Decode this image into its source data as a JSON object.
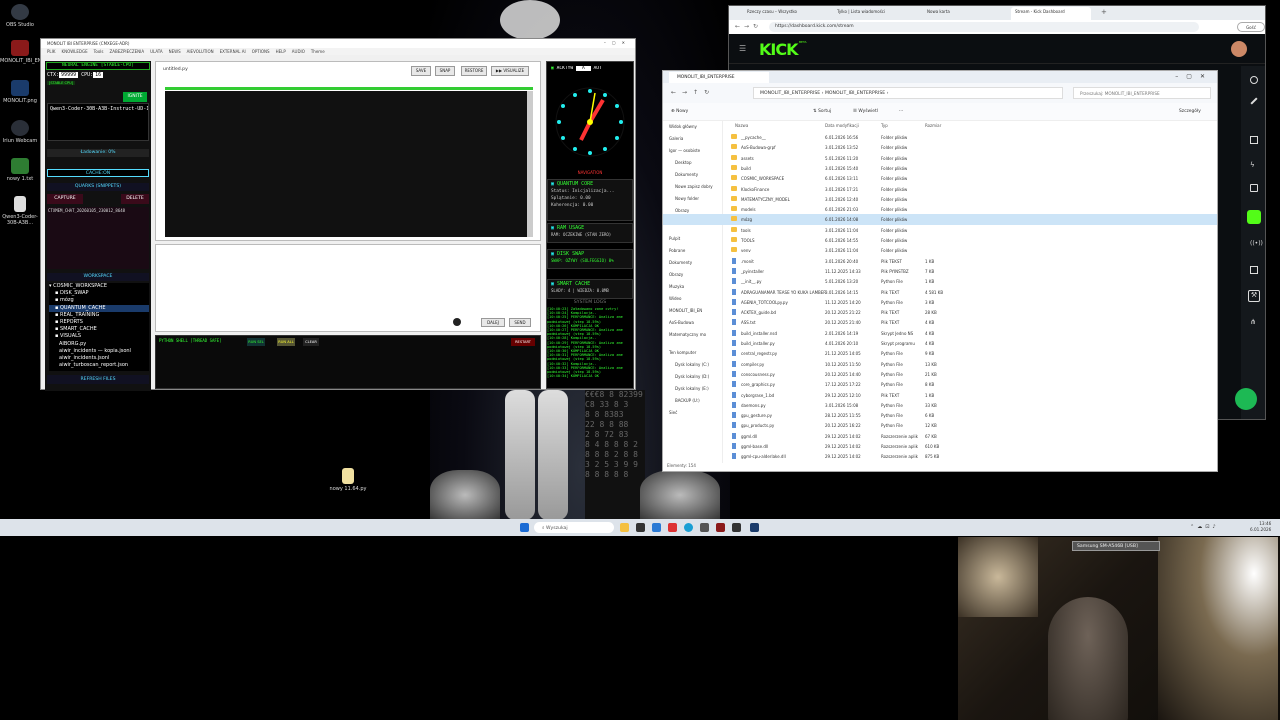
{
  "desktop": {
    "icons": [
      {
        "label": "OBS Studio",
        "color": "#333a44"
      },
      {
        "label": "MONOLIT_IBI_ENTERPRISE",
        "color": "#8b1a1a"
      },
      {
        "label": "MONOLIT.png",
        "color": "#1a3b6b"
      },
      {
        "label": "Iriun Webcam",
        "color": "#2a2f38"
      },
      {
        "label": "nowy 1.txt",
        "color": "#2e7d32"
      },
      {
        "label": "Qwen3-Coder-30B-A3B...",
        "color": "#dddddd"
      }
    ],
    "dropped_file": "nowy 11.64.py"
  },
  "app": {
    "title": "MONOLIT IBI ENTERPRISE (CMXEGE-ADR)",
    "menu": [
      "PLIK",
      "KNOWLEDGE",
      "Tools",
      "ZABEZPIECZENIA",
      "ULATA",
      "NEWS",
      "AIEVOLUTION",
      "EXTERNAL AI",
      "OPTIONS",
      "HELP",
      "AUDIO",
      "Theme"
    ],
    "neural_engine": "NEURAL ENGINE [STABLE-CPU]",
    "ctx_label": "CTX:",
    "ctx_value": "99999",
    "cpu_label": "CPU:",
    "cpu_value": "16",
    "model_status": "[STABLE CPU]",
    "ignite": "IGNITE",
    "model": "Qwen3-Coder-30B-A3B-Instruct-UD-IQ1",
    "loading": "Ładowanie: 0%",
    "cache": "CACHE:ON",
    "quarks": "QUARKS (SNIPPETS)",
    "capture": "CAPTURE",
    "delete": "DELETE",
    "quark_item": "CTXMEM_CHAT_20260105_230012_8648",
    "workspace": "WORKSPACE",
    "tree": [
      "COSMIC_WORKSPACE",
      "DISK_SWAP",
      "mózg",
      "QUANTUM_CACHE",
      "REAL_TRAINING",
      "REPORTS",
      "SMART_CACHE",
      "VISUALS",
      "AIBORG.py",
      "aiwir_incidents — kopia.jsonl",
      "aiwir_incidents.jsonl",
      "aiwir_turboscan_report.json"
    ],
    "refresh": "REFRESH FILES",
    "editor_file": "untitled.py",
    "save": "SAVE",
    "snap": "SNAP",
    "restore": "RESTORE",
    "visualize": "▶▶ VISUALIZE",
    "dalej": "DALEJ",
    "send": "SEND",
    "shell_title": "PYTHON SHELL [THREAD SAFE]",
    "run_sel": "RUN SEL",
    "run_all": "RUN ALL",
    "clear": "CLEAR",
    "restart": "RESTART",
    "actyw": "ACKTYW",
    "actyw_value": "A",
    "aut": "AUT",
    "clock_label": "NAVIGATION",
    "quantum_core": "QUANTUM CORE",
    "qc_status": "Status: Inicjalizacja...",
    "qc_splat": "Splątanie: 0.00",
    "qc_koh": "Koherencja: 0.00",
    "ram": "RAM USAGE",
    "ram_value": "RAM: OCZEKIWE (STAN ZERO)",
    "disk": "DISK SWAP",
    "disk_value": "SWAP: OŻYWY (SOLFEGGIO) 0%",
    "smart": "SMART CACHE",
    "smart_value": "ŚLADY: 4 | WIEDZA: 0.0MB",
    "syslogs": "SYSTEM LOGS",
    "logs": [
      "[10:40:23] Załadowano zone cvtry!",
      "[10:40:24] Kompilacja..",
      "[10:40:25] PERFORMANCE: Analiza zme",
      "podmiotowej (step 18.59s)",
      "[10:40:26] KOMPILACJA OK",
      "[10:40:27] PERFORMANCE: Analiza zme",
      "podmiotowej (step 18.59s)",
      "[10:40:28] Kompilacja..",
      "[10:40:29] PERFORMANCE: Analiza zme",
      "podmiotowej (step 18.59s)",
      "[10:40:30] KOMPILACJA OK",
      "[10:40:31] PERFORMANCE: Analiza zme",
      "podmiotowej (step 18.59s)",
      "[10:40:32] Kompilacja..",
      "[10:40:33] PERFORMANCE: Analiza zme",
      "podmiotowej (step 18.59s)",
      "[10:40:34] KOMPILACJA OK"
    ]
  },
  "explorer": {
    "title": "MONOLIT_IBI_ENTERPRISE",
    "breadcrumb": [
      "MONOLIT_IBI_ENTERPRISE",
      "MONOLIT_IBI_ENTERPRISE"
    ],
    "search": "Przeszukaj: MONOLIT_IBI_ENTERPRISE",
    "toolbar": [
      "Nowy",
      "Sortuj",
      "Wyświetl",
      "···"
    ],
    "details": "Szczegóły",
    "columns": [
      "Nazwa",
      "Data modyfikacji",
      "Typ",
      "Rozmiar"
    ],
    "nav": [
      "Widok główny",
      "Galeria",
      "Igor — osobiste",
      "Desktop",
      "Dokumenty",
      "Nowe zapisz dobry",
      "Nowy folder",
      "Obrazy",
      "Zależności",
      "Pulpit",
      "Pobrane",
      "Dokumenty",
      "Obrazy",
      "Muzyka",
      "Wideo",
      "MONOLIT_IBI_EN",
      "AoS-Budowa",
      "Matematyczny mo",
      "Ten komputer",
      "Dysk lokalny (C:)",
      "Dysk lokalny (D:)",
      "Dysk lokalny (E:)",
      "BACKUP (U:)",
      "Sieć"
    ],
    "rows": [
      {
        "name": "__pycache__",
        "date": "6.01.2026 16:56",
        "type": "Folder plików",
        "size": "",
        "kind": "folder"
      },
      {
        "name": "AoS-Budowa-grpf",
        "date": "3.01.2026 13:52",
        "type": "Folder plików",
        "size": "",
        "kind": "folder"
      },
      {
        "name": "assets",
        "date": "5.01.2026 11:20",
        "type": "Folder plików",
        "size": "",
        "kind": "folder"
      },
      {
        "name": "build",
        "date": "3.01.2026 15:40",
        "type": "Folder plików",
        "size": "",
        "kind": "folder"
      },
      {
        "name": "COSMIC_WORKSPACE",
        "date": "6.01.2026 13:11",
        "type": "Folder plików",
        "size": "",
        "kind": "folder"
      },
      {
        "name": "KlockoFinance",
        "date": "3.01.2026 17:21",
        "type": "Folder plików",
        "size": "",
        "kind": "folder"
      },
      {
        "name": "MATEMATYCZNY_MODEL",
        "date": "3.01.2026 12:40",
        "type": "Folder plików",
        "size": "",
        "kind": "folder"
      },
      {
        "name": "models",
        "date": "6.01.2026 21:03",
        "type": "Folder plików",
        "size": "",
        "kind": "folder"
      },
      {
        "name": "mózg",
        "date": "6.01.2026 14:08",
        "type": "Folder plików",
        "size": "",
        "kind": "folder"
      },
      {
        "name": "tools",
        "date": "3.01.2026 11:04",
        "type": "Folder plików",
        "size": "",
        "kind": "folder"
      },
      {
        "name": "TOOLS",
        "date": "6.01.2026 14:55",
        "type": "Folder plików",
        "size": "",
        "kind": "folder"
      },
      {
        "name": "venv",
        "date": "3.01.2026 11:04",
        "type": "Folder plików",
        "size": "",
        "kind": "folder"
      },
      {
        "name": ".monit",
        "date": "3.01.2026 20:40",
        "type": "Plik TEKST",
        "size": "1 KB",
        "kind": "file"
      },
      {
        "name": "_pyinstaller",
        "date": "11.12.2025 14:33",
        "type": "Plik PYINSTBZ",
        "size": "7 KB",
        "kind": "file"
      },
      {
        "name": "__init__.py",
        "date": "5.01.2026 13:20",
        "type": "Python File",
        "size": "1 KB",
        "kind": "file"
      },
      {
        "name": "ADRAGUANAMAR TEASE YO KUKA LAMBER",
        "date": "3.01.2026 14:15",
        "type": "Plik TEXT",
        "size": "4 581 KB",
        "kind": "file"
      },
      {
        "name": "AGENIA_TOTCOOLpy.py",
        "date": "11.12.2025 14:20",
        "type": "Python File",
        "size": "3 KB",
        "kind": "file"
      },
      {
        "name": "ACKTEX_guide.bd",
        "date": "20.12.2025 21:22",
        "type": "Plik TEXT",
        "size": "28 KB",
        "kind": "file"
      },
      {
        "name": "ASS.txt",
        "date": "20.12.2025 21:40",
        "type": "Plik TEXT",
        "size": "4 KB",
        "kind": "file"
      },
      {
        "name": "build_installer.nsd",
        "date": "2.01.2026 14:19",
        "type": "Skrypt Jedno NS",
        "size": "4 KB",
        "kind": "file"
      },
      {
        "name": "build_installer.py",
        "date": "4.01.2026 20:10",
        "type": "Skrypt programu",
        "size": "4 KB",
        "kind": "file"
      },
      {
        "name": "central_regestr.py",
        "date": "21.12.2025 14:05",
        "type": "Python File",
        "size": "9 KB",
        "kind": "file"
      },
      {
        "name": "compiler.py",
        "date": "10.12.2025 11:50",
        "type": "Python File",
        "size": "13 KB",
        "kind": "file"
      },
      {
        "name": "conscousness.py",
        "date": "20.12.2025 14:40",
        "type": "Python File",
        "size": "21 KB",
        "kind": "file"
      },
      {
        "name": "core_graphics.py",
        "date": "17.12.2025 17:22",
        "type": "Python File",
        "size": "8 KB",
        "kind": "file"
      },
      {
        "name": "cyborgrase_1.bd",
        "date": "29.12.2025 12:10",
        "type": "Plik TEXT",
        "size": "1 KB",
        "kind": "file"
      },
      {
        "name": "daemons.py",
        "date": "3.01.2026 15:08",
        "type": "Python File",
        "size": "33 KB",
        "kind": "file"
      },
      {
        "name": "gpu_gesture.py",
        "date": "28.12.2025 11:55",
        "type": "Python File",
        "size": "6 KB",
        "kind": "file"
      },
      {
        "name": "gpu_products.py",
        "date": "20.12.2025 16:22",
        "type": "Python File",
        "size": "12 KB",
        "kind": "file"
      },
      {
        "name": "ggml.dll",
        "date": "29.12.2025 14:02",
        "type": "Rozszerzenie aplik",
        "size": "67 KB",
        "kind": "file"
      },
      {
        "name": "ggml-base.dll",
        "date": "29.12.2025 14:02",
        "type": "Rozszerzenie aplik",
        "size": "610 KB",
        "kind": "file"
      },
      {
        "name": "ggml-cpu-alderlake.dll",
        "date": "29.12.2025 14:02",
        "type": "Rozszerzenie aplik",
        "size": "875 KB",
        "kind": "file"
      }
    ],
    "status": "Elementy: 154"
  },
  "browser": {
    "tabs": [
      "Rzeczy czasu – Wszystko",
      "Tylko | Lista wiadomości",
      "Nowa karta",
      "Stream - Kick Dashboard"
    ],
    "url": "https://dashboard.kick.com/stream",
    "logo": "KICK",
    "logo_tag": "BETA"
  },
  "taskbar": {
    "search": "Wyszukaj",
    "time": "13:46",
    "date": "6.01.2026"
  },
  "webcam": {
    "device": "Samsung SM-A546B [USB]"
  },
  "colors": {
    "green": "#3cff3c",
    "cyan": "#56d8ff",
    "kick": "#53fc18",
    "accent": "#1a6bd4"
  }
}
